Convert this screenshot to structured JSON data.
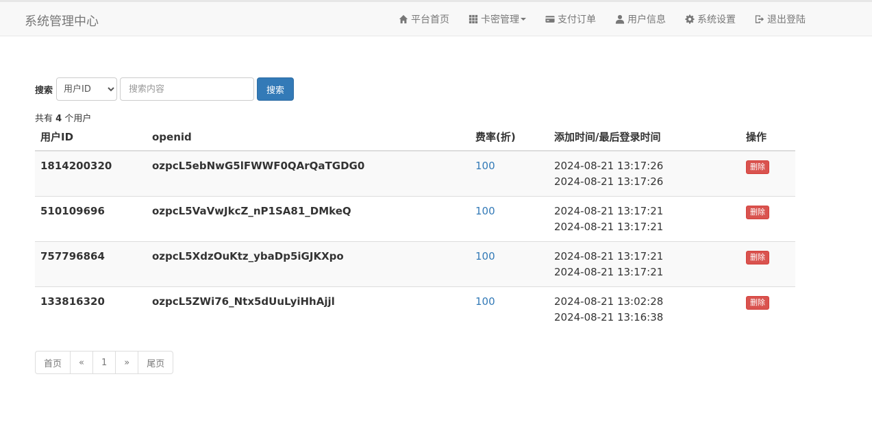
{
  "header": {
    "brand": "系统管理中心",
    "nav": [
      {
        "label": "平台首页",
        "icon": "home-icon"
      },
      {
        "label": "卡密管理",
        "icon": "grid-icon"
      },
      {
        "label": "支付订单",
        "icon": "credit-card-icon"
      },
      {
        "label": "用户信息",
        "icon": "user-icon"
      },
      {
        "label": "系统设置",
        "icon": "gear-icon"
      },
      {
        "label": "退出登陆",
        "icon": "logout-icon"
      }
    ]
  },
  "search": {
    "label": "搜索",
    "select_value": "用户ID",
    "placeholder": "搜索内容",
    "button": "搜索"
  },
  "summary": {
    "prefix": "共有",
    "count": "4",
    "suffix": "个用户"
  },
  "table": {
    "headers": [
      "用户ID",
      "openid",
      "费率(折)",
      "添加时间/最后登录时间",
      "操作"
    ],
    "rows": [
      {
        "uid": "1814200320",
        "openid": "ozpcL5ebNwG5lFWWF0QArQaTGDG0",
        "rate": "100",
        "added": "2024-08-21 13:17:26",
        "last_login": "2024-08-21 13:17:26",
        "action": "删除"
      },
      {
        "uid": "510109696",
        "openid": "ozpcL5VaVwJkcZ_nP1SA81_DMkeQ",
        "rate": "100",
        "added": "2024-08-21 13:17:21",
        "last_login": "2024-08-21 13:17:21",
        "action": "删除"
      },
      {
        "uid": "757796864",
        "openid": "ozpcL5XdzOuKtz_ybaDp5iGJKXpo",
        "rate": "100",
        "added": "2024-08-21 13:17:21",
        "last_login": "2024-08-21 13:17:21",
        "action": "删除"
      },
      {
        "uid": "133816320",
        "openid": "ozpcL5ZWi76_Ntx5dUuLyiHhAjjl",
        "rate": "100",
        "added": "2024-08-21 13:02:28",
        "last_login": "2024-08-21 13:16:38",
        "action": "删除"
      }
    ]
  },
  "pagination": [
    "首页",
    "«",
    "1",
    "»",
    "尾页"
  ],
  "colors": {
    "primary": "#337ab7",
    "danger": "#d9534f",
    "navbar_bg": "#f8f8f8"
  }
}
